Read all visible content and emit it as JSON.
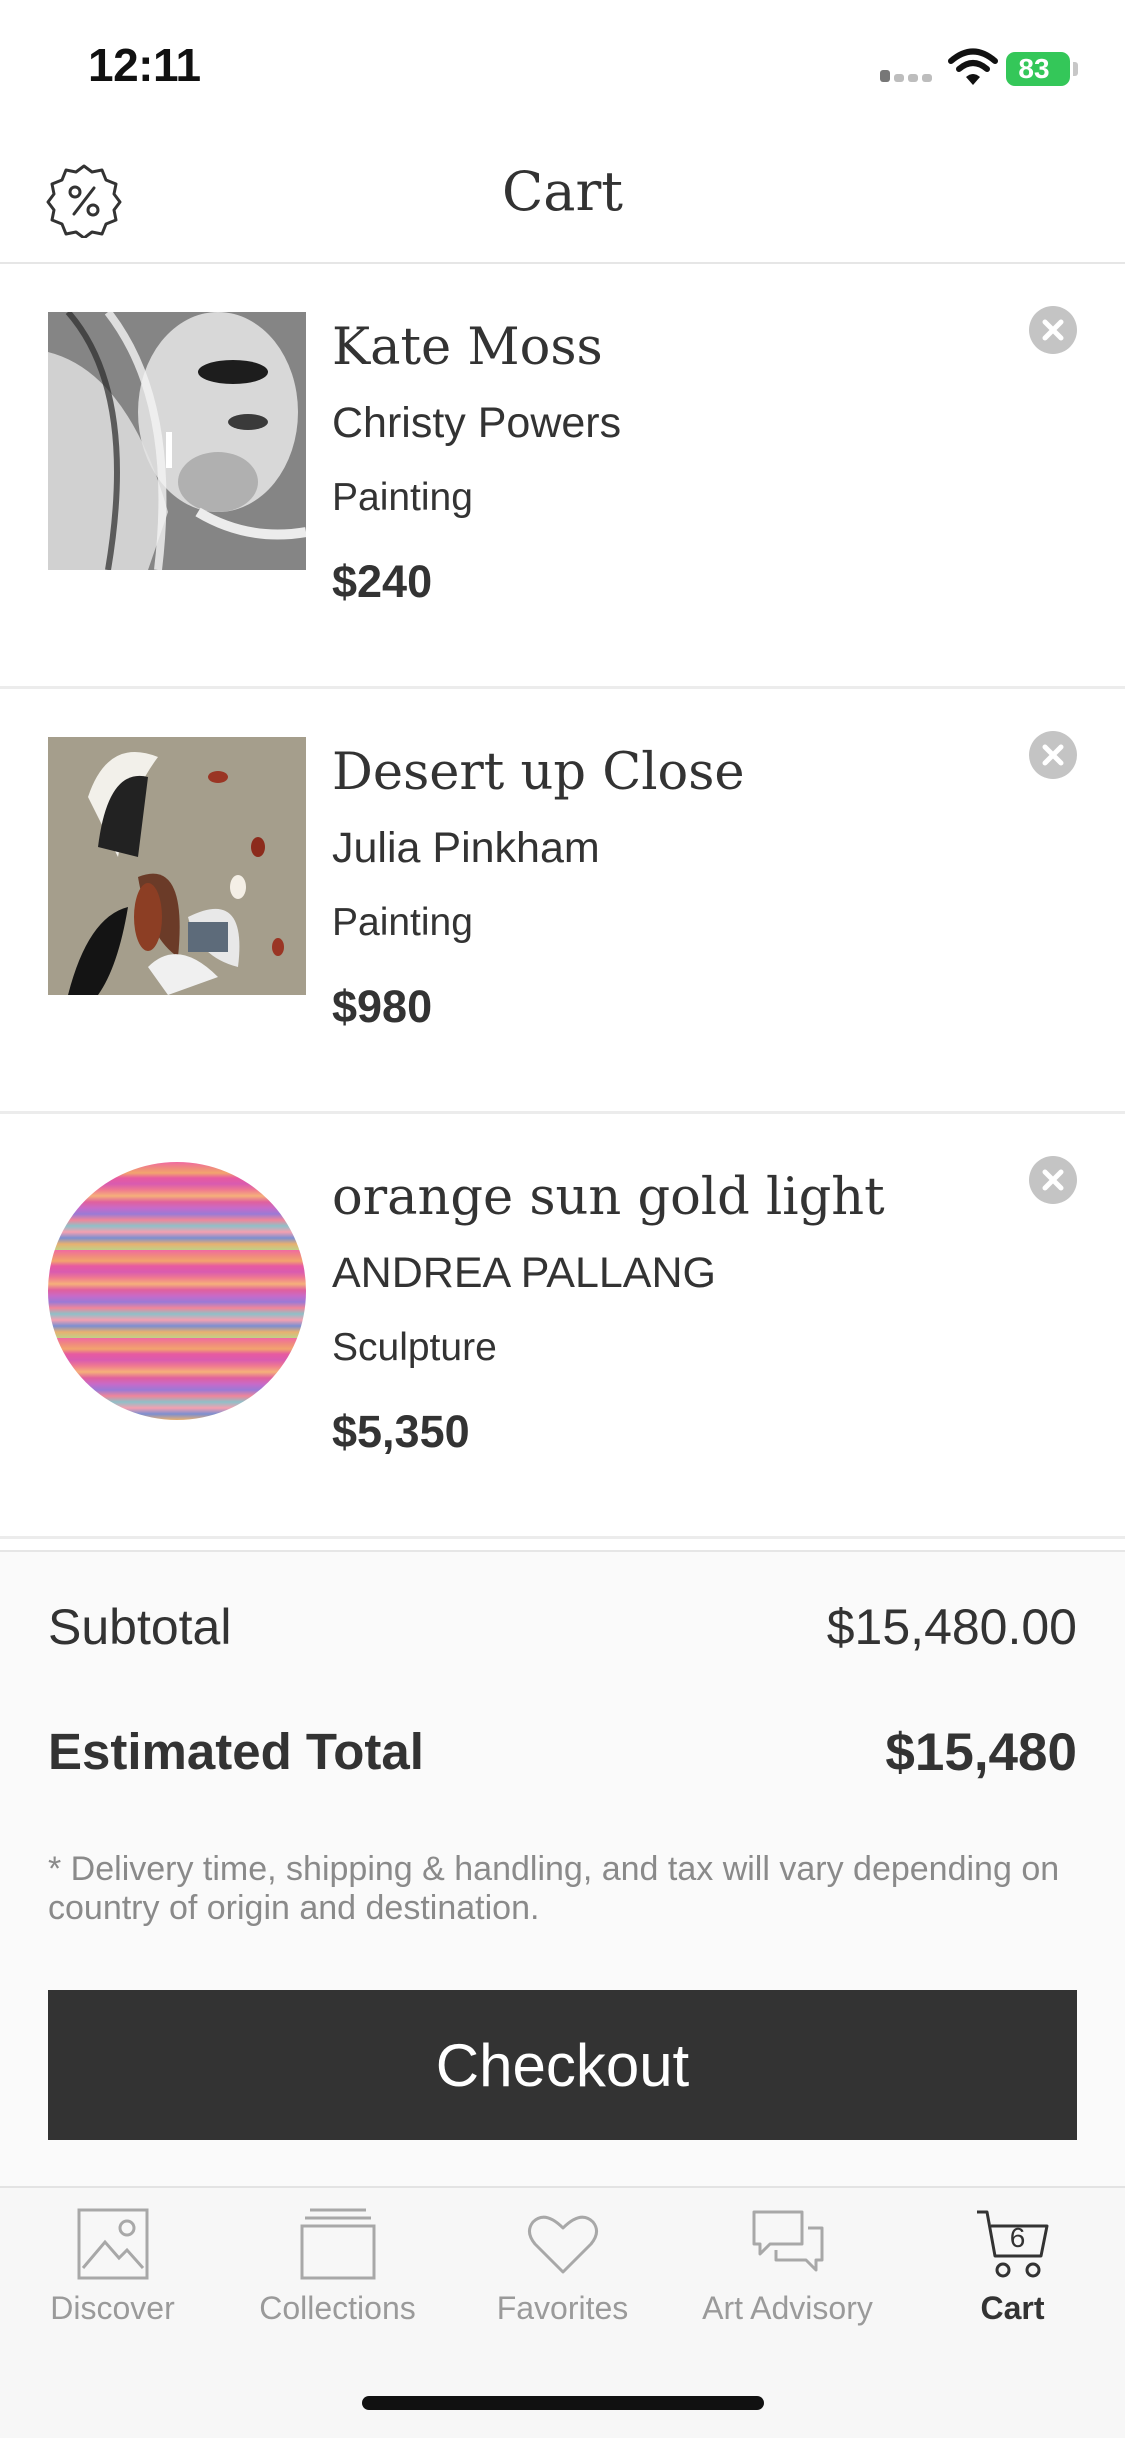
{
  "status_bar": {
    "time": "12:11",
    "battery": "83"
  },
  "header": {
    "title": "Cart"
  },
  "cart_items": [
    {
      "title": "Kate Moss",
      "artist": "Christy Powers",
      "medium": "Painting",
      "price": "$240"
    },
    {
      "title": "Desert up Close",
      "artist": "Julia Pinkham",
      "medium": "Painting",
      "price": "$980"
    },
    {
      "title": "orange sun gold light",
      "artist": "ANDREA PALLANG",
      "medium": "Sculpture",
      "price": "$5,350"
    }
  ],
  "summary": {
    "subtotal_label": "Subtotal",
    "subtotal_value": "$15,480.00",
    "estimated_total_label": "Estimated Total",
    "estimated_total_value": "$15,480",
    "note": "* Delivery time, shipping & handling, and tax will vary depending on country of origin and destination.",
    "checkout_label": "Checkout"
  },
  "tab_bar": {
    "tabs": [
      {
        "label": "Discover",
        "icon": "picture-icon"
      },
      {
        "label": "Collections",
        "icon": "collections-stack-icon"
      },
      {
        "label": "Favorites",
        "icon": "heart-icon"
      },
      {
        "label": "Art Advisory",
        "icon": "chat-bubbles-icon"
      },
      {
        "label": "Cart",
        "icon": "cart-icon",
        "badge": "6",
        "active": true
      }
    ]
  },
  "colors": {
    "text": "#333333",
    "checkout_bg": "#333333",
    "battery": "#34c759",
    "muted": "#9a9a9a"
  }
}
